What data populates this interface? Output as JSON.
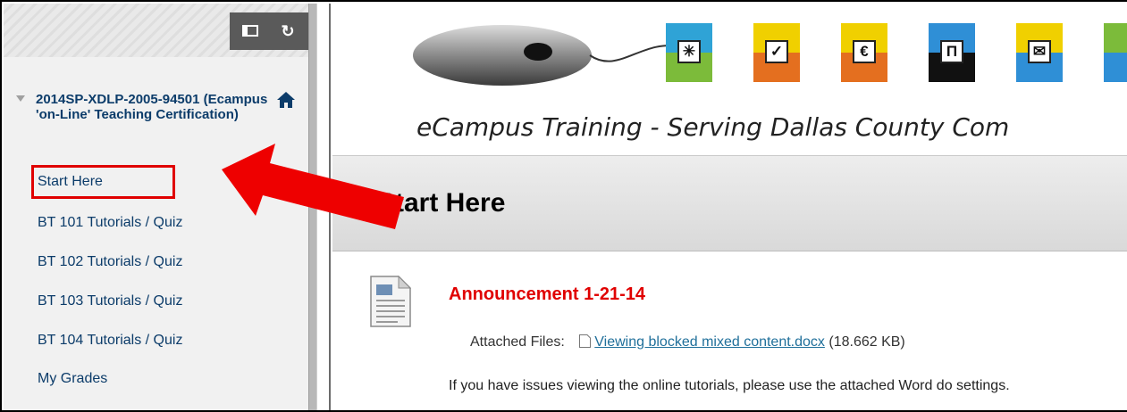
{
  "sidebar": {
    "course_title": "2014SP-XDLP-2005-94501 (Ecampus 'on-Line' Teaching Certification)",
    "items": [
      {
        "label": "Start Here"
      },
      {
        "label": "BT 101 Tutorials / Quiz"
      },
      {
        "label": "BT 102 Tutorials / Quiz"
      },
      {
        "label": "BT 103 Tutorials / Quiz"
      },
      {
        "label": "BT 104 Tutorials / Quiz"
      },
      {
        "label": "My Grades"
      }
    ],
    "tools": {
      "quick_view_icon": "quick-view-icon",
      "refresh_icon": "refresh-icon",
      "refresh_glyph": "↻"
    }
  },
  "banner": {
    "tagline": "eCampus Training - Serving Dallas County Com",
    "tiles": [
      {
        "top": "#2fa3d6",
        "bottom": "#7cbb3a",
        "glyph": "✳"
      },
      {
        "top": "#f0d000",
        "bottom": "#e46f1f",
        "glyph": "✓"
      },
      {
        "top": "#f0d000",
        "bottom": "#e46f1f",
        "glyph": "€"
      },
      {
        "top": "#2f8fd6",
        "bottom": "#111111",
        "glyph": "Π"
      },
      {
        "top": "#f0d000",
        "bottom": "#2f8fd6",
        "glyph": "✉"
      }
    ]
  },
  "main": {
    "page_title": "Start Here",
    "item": {
      "title": "Announcement 1-21-14",
      "attached_label": "Attached Files:",
      "file_name": "Viewing blocked mixed content.docx",
      "file_size": "(18.662 KB)",
      "body": "If you have issues viewing the online tutorials, please use the attached Word do settings."
    }
  },
  "colors": {
    "accent_red": "#e00000",
    "link_blue": "#0c3c6a"
  }
}
